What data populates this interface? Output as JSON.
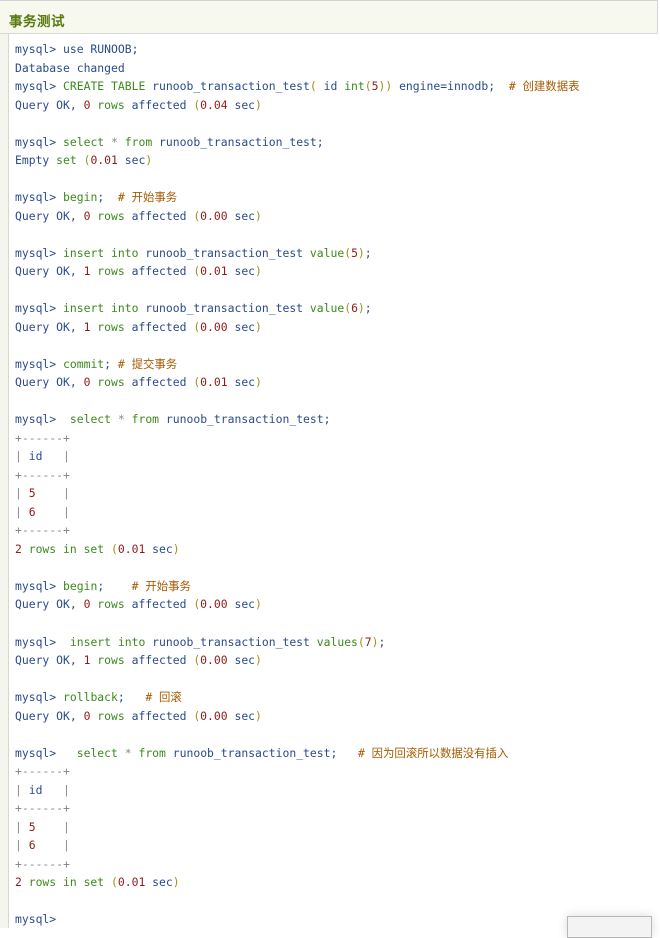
{
  "header": {
    "title": "事务测试"
  },
  "colors": {
    "plain": "#2b4b8c",
    "keyword": "#3c8a1e",
    "number": "#8e1b1b",
    "comment": "#a65a00",
    "punctuation": "#a39018",
    "table_border": "#8a8a8a",
    "title": "#5a7a10"
  },
  "code_lines": [
    [
      [
        "plain",
        "mysql> use RUNOOB;"
      ]
    ],
    [
      [
        "plain",
        "Database changed"
      ]
    ],
    [
      [
        "plain",
        "mysql> "
      ],
      [
        "kw",
        "CREATE TABLE"
      ],
      [
        "plain",
        " runoob_transaction_test"
      ],
      [
        "punc",
        "("
      ],
      [
        "plain",
        " id "
      ],
      [
        "kw",
        "int"
      ],
      [
        "punc",
        "("
      ],
      [
        "num",
        "5"
      ],
      [
        "punc",
        "))"
      ],
      [
        "plain",
        " engine=innodb;  "
      ],
      [
        "com",
        "# 创建数据表"
      ]
    ],
    [
      [
        "plain",
        "Query OK, "
      ],
      [
        "num",
        "0"
      ],
      [
        "kw",
        " rows"
      ],
      [
        "plain",
        " affected "
      ],
      [
        "punc",
        "("
      ],
      [
        "num",
        "0.04"
      ],
      [
        "plain",
        " sec"
      ],
      [
        "punc",
        ")"
      ]
    ],
    [],
    [
      [
        "plain",
        "mysql> "
      ],
      [
        "kw",
        "select"
      ],
      [
        "gray",
        " * "
      ],
      [
        "kw",
        "from"
      ],
      [
        "plain",
        " runoob_transaction_test;"
      ]
    ],
    [
      [
        "plain",
        "Empty "
      ],
      [
        "kw",
        "set"
      ],
      [
        "plain",
        " "
      ],
      [
        "punc",
        "("
      ],
      [
        "num",
        "0.01"
      ],
      [
        "plain",
        " sec"
      ],
      [
        "punc",
        ")"
      ]
    ],
    [],
    [
      [
        "plain",
        "mysql> "
      ],
      [
        "kw",
        "begin"
      ],
      [
        "plain",
        ";  "
      ],
      [
        "com",
        "# 开始事务"
      ]
    ],
    [
      [
        "plain",
        "Query OK, "
      ],
      [
        "num",
        "0"
      ],
      [
        "kw",
        " rows"
      ],
      [
        "plain",
        " affected "
      ],
      [
        "punc",
        "("
      ],
      [
        "num",
        "0.00"
      ],
      [
        "plain",
        " sec"
      ],
      [
        "punc",
        ")"
      ]
    ],
    [],
    [
      [
        "plain",
        "mysql> "
      ],
      [
        "kw",
        "insert into"
      ],
      [
        "plain",
        " runoob_transaction_test "
      ],
      [
        "kw",
        "value"
      ],
      [
        "punc",
        "("
      ],
      [
        "num",
        "5"
      ],
      [
        "punc",
        ")"
      ],
      [
        "plain",
        ";"
      ]
    ],
    [
      [
        "plain",
        "Query OK, "
      ],
      [
        "num",
        "1"
      ],
      [
        "kw",
        " rows"
      ],
      [
        "plain",
        " affected "
      ],
      [
        "punc",
        "("
      ],
      [
        "num",
        "0.01"
      ],
      [
        "plain",
        " sec"
      ],
      [
        "punc",
        ")"
      ]
    ],
    [],
    [
      [
        "plain",
        "mysql> "
      ],
      [
        "kw",
        "insert into"
      ],
      [
        "plain",
        " runoob_transaction_test "
      ],
      [
        "kw",
        "value"
      ],
      [
        "punc",
        "("
      ],
      [
        "num",
        "6"
      ],
      [
        "punc",
        ")"
      ],
      [
        "plain",
        ";"
      ]
    ],
    [
      [
        "plain",
        "Query OK, "
      ],
      [
        "num",
        "1"
      ],
      [
        "kw",
        " rows"
      ],
      [
        "plain",
        " affected "
      ],
      [
        "punc",
        "("
      ],
      [
        "num",
        "0.00"
      ],
      [
        "plain",
        " sec"
      ],
      [
        "punc",
        ")"
      ]
    ],
    [],
    [
      [
        "plain",
        "mysql> "
      ],
      [
        "kw",
        "commit"
      ],
      [
        "plain",
        "; "
      ],
      [
        "com",
        "# 提交事务"
      ]
    ],
    [
      [
        "plain",
        "Query OK, "
      ],
      [
        "num",
        "0"
      ],
      [
        "kw",
        " rows"
      ],
      [
        "plain",
        " affected "
      ],
      [
        "punc",
        "("
      ],
      [
        "num",
        "0.01"
      ],
      [
        "plain",
        " sec"
      ],
      [
        "punc",
        ")"
      ]
    ],
    [],
    [
      [
        "plain",
        "mysql>  "
      ],
      [
        "kw",
        "select"
      ],
      [
        "gray",
        " * "
      ],
      [
        "kw",
        "from"
      ],
      [
        "plain",
        " runoob_transaction_test;"
      ]
    ],
    [
      [
        "gray",
        "+------+"
      ]
    ],
    [
      [
        "gray",
        "| "
      ],
      [
        "plain",
        "id"
      ],
      [
        "gray",
        "   |"
      ]
    ],
    [
      [
        "gray",
        "+------+"
      ]
    ],
    [
      [
        "gray",
        "| "
      ],
      [
        "num",
        "5"
      ],
      [
        "gray",
        "    |"
      ]
    ],
    [
      [
        "gray",
        "| "
      ],
      [
        "num",
        "6"
      ],
      [
        "gray",
        "    |"
      ]
    ],
    [
      [
        "gray",
        "+------+"
      ]
    ],
    [
      [
        "num",
        "2"
      ],
      [
        "kw",
        " rows in set"
      ],
      [
        "plain",
        " "
      ],
      [
        "punc",
        "("
      ],
      [
        "num",
        "0.01"
      ],
      [
        "plain",
        " sec"
      ],
      [
        "punc",
        ")"
      ]
    ],
    [],
    [
      [
        "plain",
        "mysql> "
      ],
      [
        "kw",
        "begin"
      ],
      [
        "plain",
        ";    "
      ],
      [
        "com",
        "# 开始事务"
      ]
    ],
    [
      [
        "plain",
        "Query OK, "
      ],
      [
        "num",
        "0"
      ],
      [
        "kw",
        " rows"
      ],
      [
        "plain",
        " affected "
      ],
      [
        "punc",
        "("
      ],
      [
        "num",
        "0.00"
      ],
      [
        "plain",
        " sec"
      ],
      [
        "punc",
        ")"
      ]
    ],
    [],
    [
      [
        "plain",
        "mysql>  "
      ],
      [
        "kw",
        "insert into"
      ],
      [
        "plain",
        " runoob_transaction_test "
      ],
      [
        "kw",
        "values"
      ],
      [
        "punc",
        "("
      ],
      [
        "num",
        "7"
      ],
      [
        "punc",
        ")"
      ],
      [
        "plain",
        ";"
      ]
    ],
    [
      [
        "plain",
        "Query OK, "
      ],
      [
        "num",
        "1"
      ],
      [
        "kw",
        " rows"
      ],
      [
        "plain",
        " affected "
      ],
      [
        "punc",
        "("
      ],
      [
        "num",
        "0.00"
      ],
      [
        "plain",
        " sec"
      ],
      [
        "punc",
        ")"
      ]
    ],
    [],
    [
      [
        "plain",
        "mysql> "
      ],
      [
        "kw",
        "rollback"
      ],
      [
        "plain",
        ";   "
      ],
      [
        "com",
        "# 回滚"
      ]
    ],
    [
      [
        "plain",
        "Query OK, "
      ],
      [
        "num",
        "0"
      ],
      [
        "kw",
        " rows"
      ],
      [
        "plain",
        " affected "
      ],
      [
        "punc",
        "("
      ],
      [
        "num",
        "0.00"
      ],
      [
        "plain",
        " sec"
      ],
      [
        "punc",
        ")"
      ]
    ],
    [],
    [
      [
        "plain",
        "mysql>   "
      ],
      [
        "kw",
        "select"
      ],
      [
        "gray",
        " * "
      ],
      [
        "kw",
        "from"
      ],
      [
        "plain",
        " runoob_transaction_test;   "
      ],
      [
        "com",
        "# 因为回滚所以数据没有插入"
      ]
    ],
    [
      [
        "gray",
        "+------+"
      ]
    ],
    [
      [
        "gray",
        "| "
      ],
      [
        "plain",
        "id"
      ],
      [
        "gray",
        "   |"
      ]
    ],
    [
      [
        "gray",
        "+------+"
      ]
    ],
    [
      [
        "gray",
        "| "
      ],
      [
        "num",
        "5"
      ],
      [
        "gray",
        "    |"
      ]
    ],
    [
      [
        "gray",
        "| "
      ],
      [
        "num",
        "6"
      ],
      [
        "gray",
        "    |"
      ]
    ],
    [
      [
        "gray",
        "+------+"
      ]
    ],
    [
      [
        "num",
        "2"
      ],
      [
        "kw",
        " rows in set"
      ],
      [
        "plain",
        " "
      ],
      [
        "punc",
        "("
      ],
      [
        "num",
        "0.01"
      ],
      [
        "plain",
        " sec"
      ],
      [
        "punc",
        ")"
      ]
    ],
    [],
    [
      [
        "plain",
        "mysql>"
      ]
    ]
  ]
}
